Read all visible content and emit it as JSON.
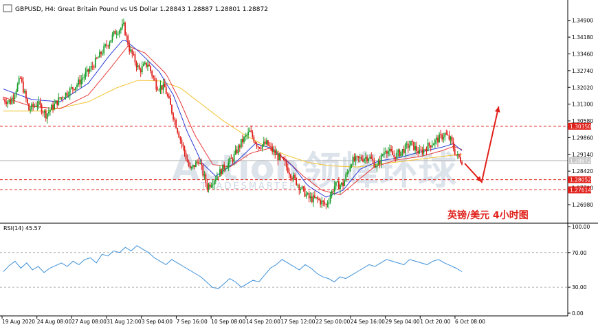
{
  "header": {
    "symbol_info": "GBPUSD, H4:  Great Britain Pound vs US Dollar  1.28843 1.28887 1.28801 1.28872",
    "rsi_label": "RSI(14) 45.57"
  },
  "annotation": {
    "title_cn": "英镑/美元  4小时图",
    "color": "#e0201a"
  },
  "watermark": {
    "text_en": "Action",
    "text_cn": "领峰环球",
    "sub": "TRADESMARTER",
    "color": "#9fb0c8"
  },
  "colors": {
    "bull": "#1a9e2a",
    "bear": "#e0201a",
    "ma_fast": "#2a3cd6",
    "ma_mid": "#e83a3a",
    "ma_slow": "#f2c331",
    "rsi_line": "#3b8fd9",
    "level_line": "#e0201a"
  },
  "chart_data": [
    {
      "type": "candlestick",
      "title": "GBPUSD, H4: Great Britain Pound vs US Dollar",
      "ylim": [
        1.263,
        1.356
      ],
      "y_ticks": [
        1.349,
        1.3418,
        1.3346,
        1.3274,
        1.3202,
        1.313,
        1.3058,
        1.2986,
        1.2914,
        1.2842,
        1.277,
        1.2698
      ],
      "y_tick_labels": [
        "1.34900",
        "1.34180",
        "1.33460",
        "1.32740",
        "1.32020",
        "1.31300",
        "1.30580",
        "1.29860",
        "1.29140",
        "1.28420",
        "1.27700",
        "1.26980"
      ],
      "x_labels": [
        "19 Aug 2020",
        "24 Aug 08:00",
        "27 Aug 08:00",
        "31 Aug 12:00",
        "3 Sep 04:00",
        "7 Sep 16:00",
        "10 Sep 08:00",
        "14 Sep 20:00",
        "17 Sep 12:00",
        "22 Sep 00:00",
        "24 Sep 16:00",
        "29 Sep 04:00",
        "1 Oct 20:00",
        "6 Oct 08:00"
      ],
      "price_path": [
        [
          0,
          1.315
        ],
        [
          5,
          1.314
        ],
        [
          12,
          1.324
        ],
        [
          18,
          1.3105
        ],
        [
          24,
          1.3135
        ],
        [
          30,
          1.3085
        ],
        [
          40,
          1.3155
        ],
        [
          52,
          1.3215
        ],
        [
          62,
          1.3285
        ],
        [
          72,
          1.3375
        ],
        [
          79,
          1.344
        ],
        [
          85,
          1.3465
        ],
        [
          89,
          1.3368
        ],
        [
          96,
          1.3275
        ],
        [
          102,
          1.3305
        ],
        [
          108,
          1.321
        ],
        [
          114,
          1.32
        ],
        [
          120,
          1.308
        ],
        [
          126,
          1.296
        ],
        [
          132,
          1.2845
        ],
        [
          138,
          1.289
        ],
        [
          144,
          1.2775
        ],
        [
          150,
          1.2815
        ],
        [
          156,
          1.286
        ],
        [
          162,
          1.2895
        ],
        [
          168,
          1.2965
        ],
        [
          174,
          1.301
        ],
        [
          180,
          1.295
        ],
        [
          186,
          1.296
        ],
        [
          192,
          1.2915
        ],
        [
          198,
          1.288
        ],
        [
          204,
          1.282
        ],
        [
          210,
          1.277
        ],
        [
          216,
          1.2725
        ],
        [
          222,
          1.272
        ],
        [
          228,
          1.2695
        ],
        [
          234,
          1.278
        ],
        [
          240,
          1.2785
        ],
        [
          246,
          1.2885
        ],
        [
          252,
          1.2895
        ],
        [
          258,
          1.2905
        ],
        [
          264,
          1.286
        ],
        [
          270,
          1.294
        ],
        [
          276,
          1.2905
        ],
        [
          282,
          1.293
        ],
        [
          288,
          1.296
        ],
        [
          294,
          1.292
        ],
        [
          300,
          1.295
        ],
        [
          306,
          1.2975
        ],
        [
          312,
          1.3
        ],
        [
          316,
          1.2975
        ],
        [
          320,
          1.291
        ],
        [
          324,
          1.2887
        ]
      ],
      "ma_fast": [
        [
          0,
          1.3195
        ],
        [
          20,
          1.315
        ],
        [
          40,
          1.314
        ],
        [
          60,
          1.322
        ],
        [
          75,
          1.334
        ],
        [
          85,
          1.341
        ],
        [
          95,
          1.336
        ],
        [
          110,
          1.327
        ],
        [
          120,
          1.317
        ],
        [
          130,
          1.301
        ],
        [
          140,
          1.288
        ],
        [
          150,
          1.282
        ],
        [
          165,
          1.2885
        ],
        [
          178,
          1.296
        ],
        [
          190,
          1.294
        ],
        [
          205,
          1.286
        ],
        [
          215,
          1.278
        ],
        [
          228,
          1.273
        ],
        [
          240,
          1.276
        ],
        [
          252,
          1.285
        ],
        [
          265,
          1.2885
        ],
        [
          280,
          1.29
        ],
        [
          295,
          1.2925
        ],
        [
          310,
          1.2945
        ],
        [
          318,
          1.296
        ],
        [
          324,
          1.293
        ]
      ],
      "ma_mid": [
        [
          0,
          1.316
        ],
        [
          20,
          1.312
        ],
        [
          40,
          1.311
        ],
        [
          60,
          1.317
        ],
        [
          75,
          1.328
        ],
        [
          88,
          1.338
        ],
        [
          100,
          1.335
        ],
        [
          115,
          1.326
        ],
        [
          125,
          1.314
        ],
        [
          135,
          1.3
        ],
        [
          148,
          1.287
        ],
        [
          160,
          1.286
        ],
        [
          175,
          1.292
        ],
        [
          188,
          1.294
        ],
        [
          200,
          1.289
        ],
        [
          212,
          1.282
        ],
        [
          225,
          1.276
        ],
        [
          238,
          1.274
        ],
        [
          250,
          1.28
        ],
        [
          262,
          1.286
        ],
        [
          278,
          1.289
        ],
        [
          295,
          1.2905
        ],
        [
          310,
          1.293
        ],
        [
          318,
          1.2948
        ],
        [
          324,
          1.2935
        ]
      ],
      "ma_slow": [
        [
          0,
          1.31
        ],
        [
          30,
          1.31
        ],
        [
          60,
          1.314
        ],
        [
          80,
          1.32
        ],
        [
          95,
          1.3232
        ],
        [
          110,
          1.323
        ],
        [
          125,
          1.32
        ],
        [
          140,
          1.313
        ],
        [
          155,
          1.306
        ],
        [
          170,
          1.3
        ],
        [
          185,
          1.295
        ],
        [
          200,
          1.291
        ],
        [
          215,
          1.288
        ],
        [
          230,
          1.2865
        ],
        [
          250,
          1.286
        ],
        [
          270,
          1.2875
        ],
        [
          290,
          1.289
        ],
        [
          310,
          1.2905
        ],
        [
          324,
          1.2915
        ]
      ],
      "levels": [
        {
          "value": 1.3035,
          "label": "1.30350",
          "current": false
        },
        {
          "value": 1.28872,
          "label": "1.28872",
          "current": true
        },
        {
          "value": 1.28052,
          "label": "1.28052",
          "current": false
        },
        {
          "value": 1.27614,
          "label": "1.27614",
          "current": false
        }
      ],
      "forecast_path": [
        [
          326,
          1.2875
        ],
        [
          338,
          1.2795
        ],
        [
          350,
          1.312
        ]
      ]
    },
    {
      "type": "line",
      "title": "RSI(14) 45.57",
      "ylim": [
        0,
        100
      ],
      "y_ticks": [
        100,
        70,
        30,
        0
      ],
      "y_tick_labels": [
        "100.00",
        "70.00",
        "30.00",
        "0.00"
      ],
      "reference_lines": [
        70,
        30
      ],
      "values": [
        48,
        55,
        60,
        52,
        58,
        50,
        54,
        47,
        52,
        55,
        58,
        54,
        60,
        56,
        62,
        64,
        58,
        68,
        66,
        72,
        70,
        76,
        72,
        78,
        74,
        70,
        64,
        60,
        56,
        62,
        58,
        54,
        50,
        46,
        42,
        36,
        30,
        28,
        34,
        40,
        36,
        30,
        34,
        38,
        36,
        44,
        52,
        56,
        62,
        58,
        54,
        50,
        56,
        52,
        46,
        42,
        40,
        36,
        42,
        40,
        44,
        48,
        52,
        56,
        54,
        58,
        62,
        60,
        58,
        56,
        62,
        60,
        58,
        56,
        60,
        62,
        58,
        55,
        52,
        48
      ]
    }
  ]
}
